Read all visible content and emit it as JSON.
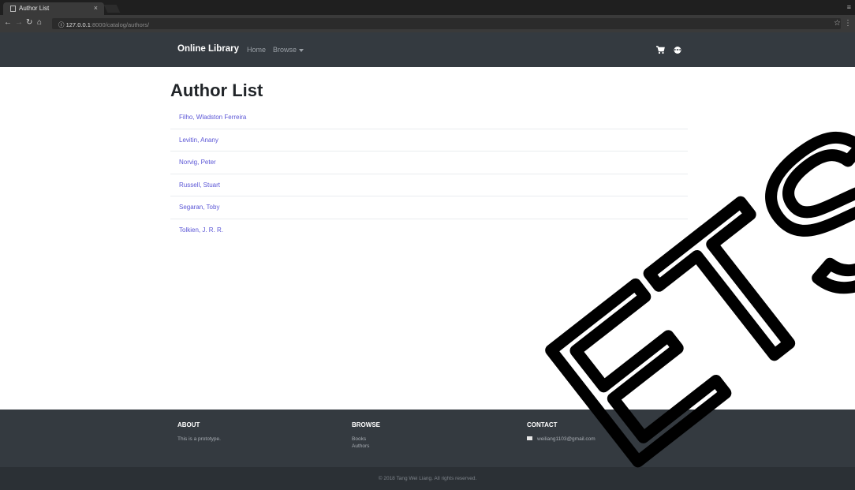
{
  "browser": {
    "tab_title": "Author List",
    "tab_close": "×",
    "url_host": "127.0.0.1",
    "url_path": ":8000/catalog/authors/"
  },
  "navbar": {
    "brand": "Online Library",
    "home": "Home",
    "browse": "Browse",
    "icons": [
      "cart-icon",
      "user-icon"
    ]
  },
  "main": {
    "title": "Author List",
    "authors": [
      "Filho, Wladston Ferreira",
      "Levitin, Anany",
      "Norvig, Peter",
      "Russell, Stuart",
      "Segaran, Toby",
      "Tolkien, J. R. R."
    ]
  },
  "watermark": "ETSM",
  "footer": {
    "about_title": "ABOUT",
    "about_text": "This is a prototype.",
    "browse_title": "BROWSE",
    "browse_books": "Books",
    "browse_authors": "Authors",
    "contact_title": "CONTACT",
    "contact_email": "weiliang1103@gmail.com",
    "copyright": "© 2018 Tang Wei Liang. All rights reserved."
  },
  "colors": {
    "navbar_bg": "#343a40",
    "link": "#5b56d6",
    "footer_bottom_bg": "#2b3035"
  }
}
